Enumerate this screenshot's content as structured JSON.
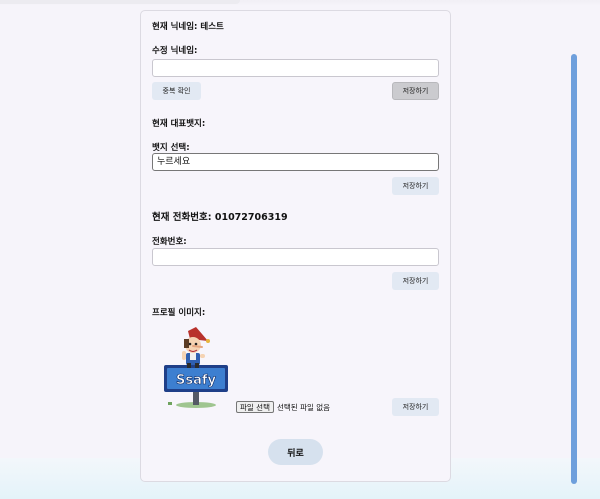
{
  "profile": {
    "current_nickname": "현재 닉네임: 테스트",
    "edit_nickname_label": "수정 닉네임:",
    "nickname_value": "",
    "check_duplicate_label": "중복 확인",
    "save_nickname_label": "저장하기",
    "current_badge_label": "현재 대표뱃지:",
    "badge_select_label": "뱃지 선택:",
    "badge_selected": "누르세요",
    "save_badge_label": "저장하기",
    "current_phone": "현재 전화번호: 01072706319",
    "phone_label": "전화번호:",
    "phone_value": "",
    "save_phone_label": "저장하기",
    "profile_image_label": "프로필 이미지:",
    "avatar_sign_text": "Ssafy",
    "file_button_label": "파일 선택",
    "file_status": "선택된 파일 없음",
    "save_image_label": "저장하기",
    "back_label": "뒤로"
  },
  "colors": {
    "scrollbar": "#6e9fdc",
    "button_bg": "#e2e9f3",
    "back_button_bg": "#d6e1ee"
  }
}
